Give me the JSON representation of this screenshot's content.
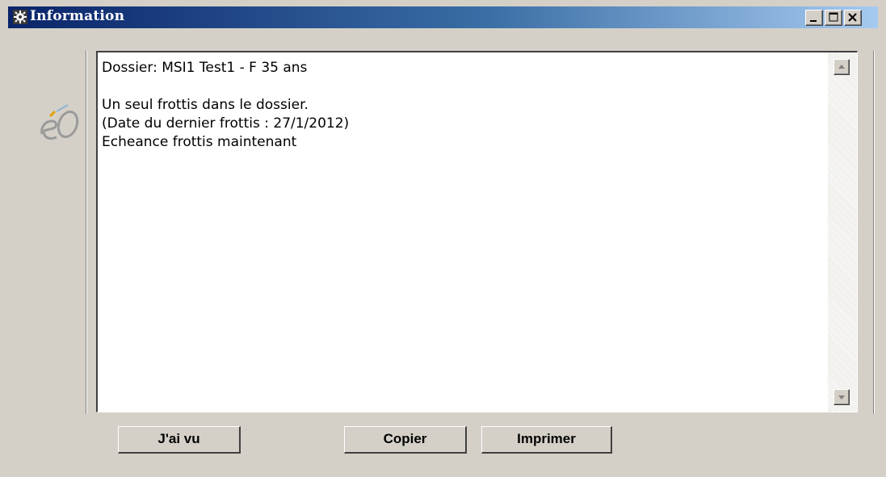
{
  "window": {
    "title": "Information",
    "title_bar_gradient": [
      "#0a246a",
      "#a6caf0"
    ],
    "caption_buttons": {
      "minimize": "minimize-icon",
      "maximize": "maximize-icon",
      "close": "close-icon"
    }
  },
  "logo": {
    "icon": "eo-logo"
  },
  "message": {
    "lines": [
      "Dossier: MSI1 Test1 - F 35 ans",
      "",
      "Un seul frottis dans le dossier.",
      "(Date du dernier frottis : 27/1/2012)",
      "Echeance frottis maintenant"
    ]
  },
  "buttons": {
    "seen": "J'ai vu",
    "copy": "Copier",
    "print": "Imprimer"
  }
}
